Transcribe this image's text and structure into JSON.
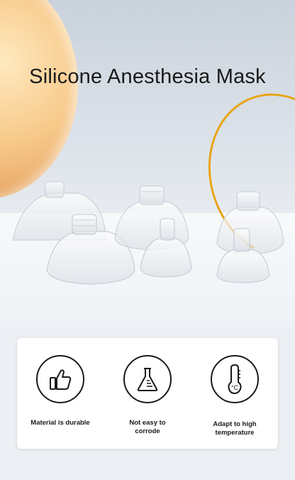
{
  "title": "Silicone Anesthesia Mask",
  "features": [
    {
      "label": "Material is durable",
      "icon": "thumbs-up-icon"
    },
    {
      "label": "Not easy to corrode",
      "icon": "flask-icon"
    },
    {
      "label": "Adapt to high temperature",
      "icon": "thermometer-icon",
      "unit": "°C"
    }
  ],
  "colors": {
    "accent_ring": "#e8a417",
    "orb": "#f7c98a",
    "text": "#1a1a1a"
  }
}
